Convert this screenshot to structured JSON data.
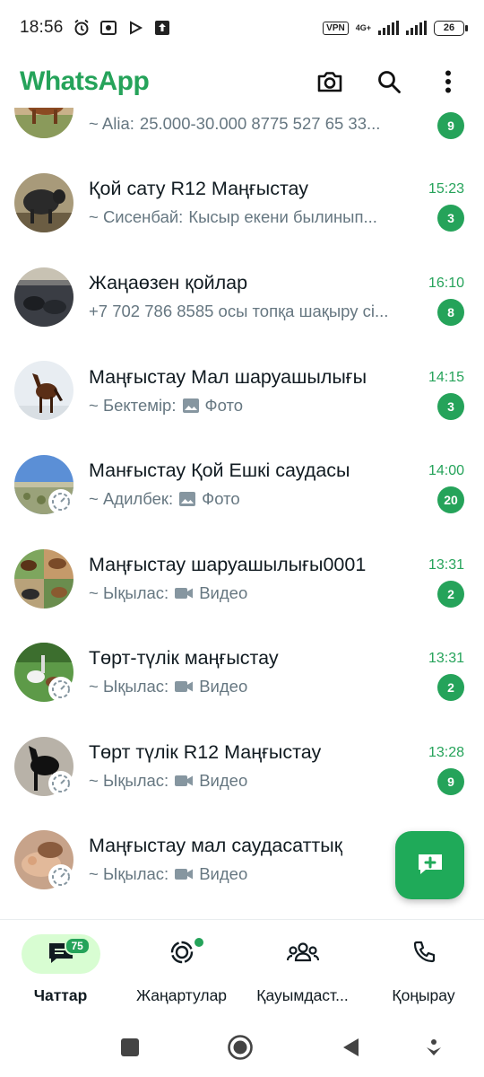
{
  "status_bar": {
    "time": "18:56",
    "vpn": "VPN",
    "network": "4G+",
    "battery": "26"
  },
  "header": {
    "title": "WhatsApp",
    "brand_color": "#25a35a"
  },
  "chats": [
    {
      "name": "",
      "sender": "~ Alia:",
      "message": "25.000-30.000  8775 527 65 33...",
      "time": "",
      "unread": "9",
      "media": ""
    },
    {
      "name": "Қой сату R12 Маңғыстау",
      "sender": "~ Сисенбай:",
      "message": "Кысыр екени былинып...",
      "time": "15:23",
      "unread": "3",
      "media": ""
    },
    {
      "name": "Жаңаөзен қойлар",
      "sender": "",
      "message": "+7 702 786 8585 осы топқа шақыру сі...",
      "time": "16:10",
      "unread": "8",
      "media": ""
    },
    {
      "name": "Маңғыстау Мал шаруашылығы",
      "sender": "~ Бектемір:",
      "message": "Фото",
      "time": "14:15",
      "unread": "3",
      "media": "photo"
    },
    {
      "name": "Манғыстау Қой Ешкі саудасы",
      "sender": "~ Адилбек:",
      "message": "Фото",
      "time": "14:00",
      "unread": "20",
      "media": "photo"
    },
    {
      "name": "Маңғыстау шаруашылығы0001",
      "sender": "~ Ықылас:",
      "message": "Видео",
      "time": "13:31",
      "unread": "2",
      "media": "video"
    },
    {
      "name": "Төрт-түлік маңғыстау",
      "sender": "~ Ықылас:",
      "message": "Видео",
      "time": "13:31",
      "unread": "2",
      "media": "video"
    },
    {
      "name": "Төрт түлік R12 Маңғыстау",
      "sender": "~ Ықылас:",
      "message": "Видео",
      "time": "13:28",
      "unread": "9",
      "media": "video"
    },
    {
      "name": "Маңғыстау мал саудасаттық",
      "sender": "~ Ықылас:",
      "message": "Видео",
      "time": "",
      "unread": "",
      "media": "video"
    }
  ],
  "bottom_nav": {
    "chats": {
      "label": "Чаттар",
      "badge": "75"
    },
    "updates": {
      "label": "Жаңартулар"
    },
    "communities": {
      "label": "Қауымдаст..."
    },
    "calls": {
      "label": "Қоңырау"
    }
  },
  "colors": {
    "accent": "#25a35a",
    "active_pill": "#d8fdd2",
    "muted_text": "#667781"
  }
}
